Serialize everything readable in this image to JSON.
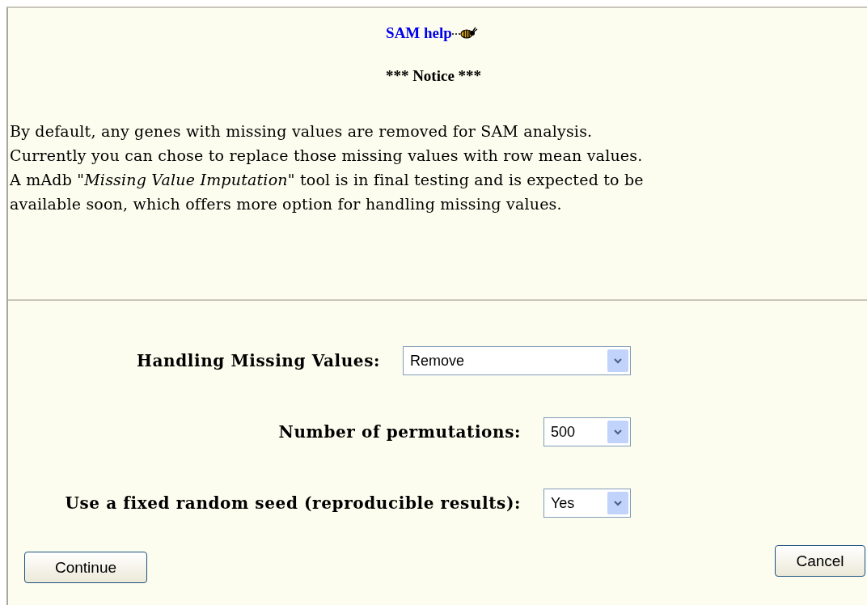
{
  "help_link": "SAM help",
  "notice_title": "*** Notice ***",
  "notice_lines": [
    "By default, any genes with missing values are removed for SAM analysis.",
    "Currently you can chose to replace those missing values with row mean values.",
    "A mAdb \"*Missing Value Imputation*\" tool is in final testing and is expected to be",
    "available soon, which offers more option for handling missing values."
  ],
  "fields": [
    {
      "label": "Handling Missing Values:",
      "value": "Remove"
    },
    {
      "label": "Number of permutations:",
      "value": "500"
    },
    {
      "label": "Use a fixed random seed (reproducible results):",
      "value": "Yes"
    }
  ],
  "buttons": [
    {
      "label": "Continue",
      "kind": "continue"
    },
    {
      "label": "Cancel",
      "kind": "cancel"
    }
  ]
}
